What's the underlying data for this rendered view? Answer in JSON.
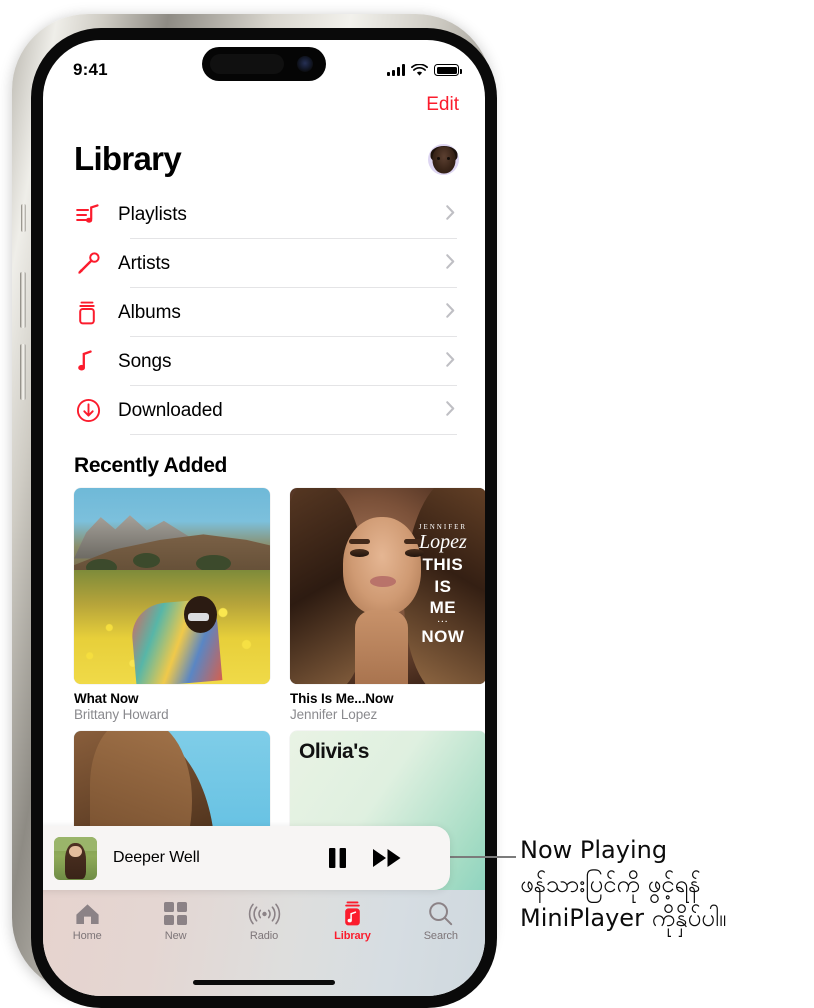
{
  "status_bar": {
    "time": "9:41",
    "signal_icon": "cellular-signal-icon",
    "wifi_icon": "wifi-icon",
    "battery_icon": "battery-full-icon"
  },
  "nav": {
    "edit_label": "Edit",
    "title": "Library",
    "avatar_name": "account-avatar"
  },
  "library_items": [
    {
      "label": "Playlists",
      "icon": "playlists-icon"
    },
    {
      "label": "Artists",
      "icon": "microphone-icon"
    },
    {
      "label": "Albums",
      "icon": "albums-icon"
    },
    {
      "label": "Songs",
      "icon": "music-note-icon"
    },
    {
      "label": "Downloaded",
      "icon": "download-circle-icon"
    }
  ],
  "recently_added": {
    "section_title": "Recently Added",
    "albums": [
      {
        "title": "What Now",
        "artist": "Brittany Howard"
      },
      {
        "title": "This Is Me...Now",
        "artist": "Jennifer Lopez"
      }
    ],
    "jlo_art": {
      "jennifer": "JENNIFER",
      "script": "Lopez",
      "line1": "THIS",
      "line2": "IS",
      "line3": "ME",
      "dots": "...",
      "line4": "NOW"
    },
    "partial_album_title": "Olivia's"
  },
  "mini_player": {
    "track_title": "Deeper Well",
    "pause_icon": "pause-icon",
    "next_icon": "fast-forward-icon"
  },
  "tab_bar": {
    "tabs": [
      {
        "label": "Home",
        "icon": "house-icon",
        "active": false
      },
      {
        "label": "New",
        "icon": "grid-icon",
        "active": false
      },
      {
        "label": "Radio",
        "icon": "broadcast-icon",
        "active": false
      },
      {
        "label": "Library",
        "icon": "library-icon",
        "active": true
      },
      {
        "label": "Search",
        "icon": "search-icon",
        "active": false
      }
    ]
  },
  "annotation": {
    "line1": "Now Playing",
    "line2": "ဖန်သားပြင်ကို ဖွင့်ရန်",
    "line3": "MiniPlayer ကိုနှိပ်ပါ။"
  },
  "colors": {
    "accent_red": "#fb1c2d",
    "secondary_text": "#8a8a8e",
    "separator": "#e4e4e6"
  }
}
